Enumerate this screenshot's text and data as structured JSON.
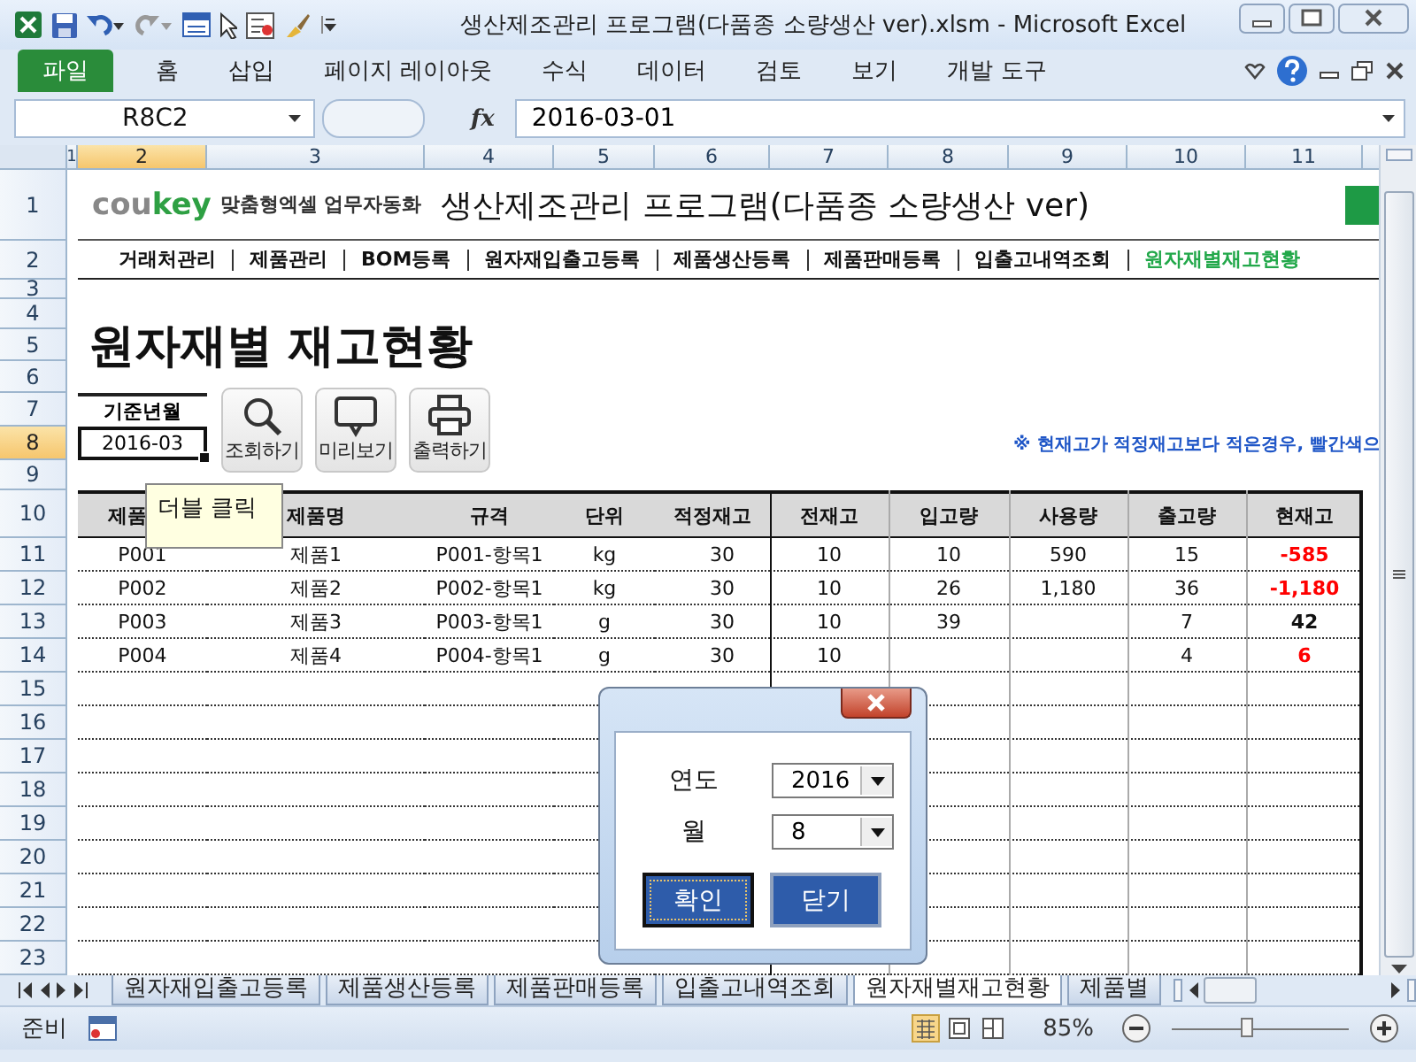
{
  "window": {
    "title": "생산제조관리 프로그램(다품종 소량생산 ver).xlsm  -  Microsoft Excel"
  },
  "ribbon": {
    "file_tab": "파일",
    "tabs": [
      "홈",
      "삽입",
      "페이지 레이아웃",
      "수식",
      "데이터",
      "검토",
      "보기",
      "개발 도구"
    ]
  },
  "formula_bar": {
    "name_box": "R8C2",
    "function_label": "fx",
    "value": "2016-03-01"
  },
  "column_headers": [
    {
      "label": "1",
      "selected": false
    },
    {
      "label": "2",
      "selected": true
    },
    {
      "label": "3",
      "selected": false
    },
    {
      "label": "4",
      "selected": false
    },
    {
      "label": "5",
      "selected": false
    },
    {
      "label": "6",
      "selected": false
    },
    {
      "label": "7",
      "selected": false
    },
    {
      "label": "8",
      "selected": false
    },
    {
      "label": "9",
      "selected": false
    },
    {
      "label": "10",
      "selected": false
    },
    {
      "label": "11",
      "selected": false
    }
  ],
  "row_headers": [
    {
      "label": "1",
      "selected": false
    },
    {
      "label": "2",
      "selected": false
    },
    {
      "label": "3",
      "selected": false
    },
    {
      "label": "4",
      "selected": false
    },
    {
      "label": "5",
      "selected": false
    },
    {
      "label": "6",
      "selected": false
    },
    {
      "label": "7",
      "selected": false
    },
    {
      "label": "8",
      "selected": true
    },
    {
      "label": "9",
      "selected": false
    },
    {
      "label": "10",
      "selected": false
    },
    {
      "label": "11",
      "selected": false
    },
    {
      "label": "12",
      "selected": false
    },
    {
      "label": "13",
      "selected": false
    },
    {
      "label": "14",
      "selected": false
    },
    {
      "label": "15",
      "selected": false
    },
    {
      "label": "16",
      "selected": false
    },
    {
      "label": "17",
      "selected": false
    },
    {
      "label": "18",
      "selected": false
    },
    {
      "label": "19",
      "selected": false
    },
    {
      "label": "20",
      "selected": false
    },
    {
      "label": "21",
      "selected": false
    },
    {
      "label": "22",
      "selected": false
    },
    {
      "label": "23",
      "selected": false
    }
  ],
  "sheet": {
    "logo": {
      "gray_part": "cou",
      "green_part": "key",
      "tagline": "맞춤형엑셀 업무자동화"
    },
    "program_title": "생산제조관리 프로그램(다품종 소량생산 ver)",
    "nav": [
      {
        "label": "거래처관리",
        "selected": false
      },
      {
        "label": "제품관리",
        "selected": false
      },
      {
        "label": "BOM등록",
        "selected": false
      },
      {
        "label": "원자재입출고등록",
        "selected": false
      },
      {
        "label": "제품생산등록",
        "selected": false
      },
      {
        "label": "제품판매등록",
        "selected": false
      },
      {
        "label": "입출고내역조회",
        "selected": false
      },
      {
        "label": "원자재별재고현황",
        "selected": true
      }
    ],
    "page_title": "원자재별 재고현황",
    "base_month": {
      "label": "기준년월",
      "value": "2016-03"
    },
    "actions": [
      {
        "label": "조회하기",
        "kind": "search"
      },
      {
        "label": "미리보기",
        "kind": "preview"
      },
      {
        "label": "출력하기",
        "kind": "print"
      }
    ],
    "note": "※ 현재고가 적정재고보다 적은경우, 빨간색으"
  },
  "table": {
    "columns": [
      "제품",
      "제품명",
      "규격",
      "단위",
      "적정재고",
      "전재고",
      "입고량",
      "사용량",
      "출고량",
      "현재고"
    ],
    "rows": [
      {
        "cells": [
          "P001",
          "제품1",
          "P001-항목1",
          "kg",
          "30",
          "10",
          "10",
          "590",
          "15",
          "-585"
        ],
        "low_stock": true
      },
      {
        "cells": [
          "P002",
          "제품2",
          "P002-항목1",
          "kg",
          "30",
          "10",
          "26",
          "1,180",
          "36",
          "-1,180"
        ],
        "low_stock": true
      },
      {
        "cells": [
          "P003",
          "제품3",
          "P003-항목1",
          "g",
          "30",
          "10",
          "39",
          null,
          "7",
          "42"
        ],
        "low_stock": false
      },
      {
        "cells": [
          "P004",
          "제품4",
          "P004-항목1",
          "g",
          "30",
          "10",
          null,
          null,
          "4",
          "6"
        ],
        "low_stock": true
      }
    ]
  },
  "tooltip": "더블 클릭",
  "dialog": {
    "fields": [
      {
        "label": "연도",
        "value": "2016"
      },
      {
        "label": "월",
        "value": "8"
      }
    ],
    "buttons": [
      {
        "label": "확인",
        "focused": true
      },
      {
        "label": "닫기",
        "focused": false
      }
    ]
  },
  "sheet_tabs": [
    {
      "label": "원자재입출고등록",
      "selected": false
    },
    {
      "label": "제품생산등록",
      "selected": false
    },
    {
      "label": "제품판매등록",
      "selected": false
    },
    {
      "label": "입출고내역조회",
      "selected": false
    },
    {
      "label": "원자재별재고현황",
      "selected": true
    },
    {
      "label": "제품별",
      "selected": false
    }
  ],
  "status_bar": {
    "mode": "준비",
    "zoom": "85%",
    "zoom_slider": {
      "level": 0.42
    }
  }
}
